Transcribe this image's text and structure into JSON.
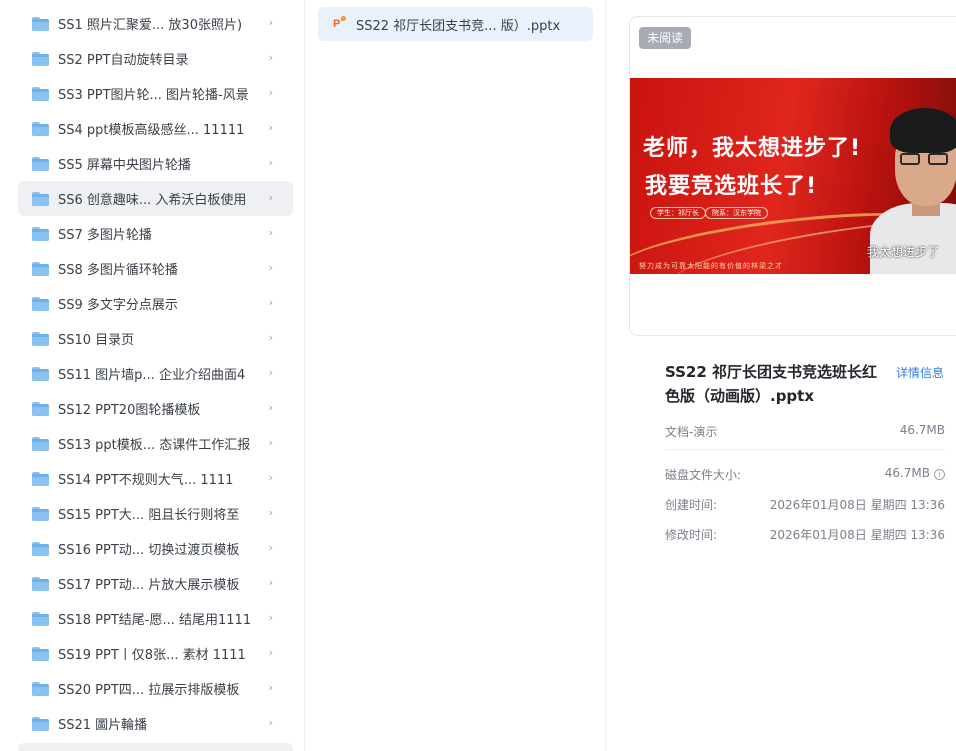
{
  "folders": [
    {
      "label": "SS1 照片汇聚爱...  放30张照片)",
      "active": false
    },
    {
      "label": "SS2 PPT自动旋转目录",
      "active": false
    },
    {
      "label": "SS3 PPT图片轮... 图片轮播-风景",
      "active": false
    },
    {
      "label": "SS4 ppt模板高级感丝...   11111",
      "active": false
    },
    {
      "label": "SS5 屏幕中央图片轮播",
      "active": false
    },
    {
      "label": "SS6 创意趣味... 入希沃白板使用",
      "active": true
    },
    {
      "label": "SS7 多图片轮播",
      "active": false
    },
    {
      "label": "SS8 多图片循环轮播",
      "active": false
    },
    {
      "label": "SS9 多文字分点展示",
      "active": false
    },
    {
      "label": "SS10 目录页",
      "active": false
    },
    {
      "label": "SS11 图片墙p...  企业介绍曲面4",
      "active": false
    },
    {
      "label": "SS12 PPT20图轮播模板",
      "active": false
    },
    {
      "label": "SS13 ppt模板... 态课件工作汇报",
      "active": false
    },
    {
      "label": "SS14 PPT不规则大气...     1111",
      "active": false
    },
    {
      "label": "SS15 PPT大...   阻且长行则将至",
      "active": false
    },
    {
      "label": "SS16 PPT动...   切换过渡页模板",
      "active": false
    },
    {
      "label": "SS17 PPT动...   片放大展示模板",
      "active": false
    },
    {
      "label": "SS18 PPT结尾-愿... 结尾用1111",
      "active": false
    },
    {
      "label": "SS19 PPT丨仅8张...   素材 1111",
      "active": false
    },
    {
      "label": "SS20 PPT四...   拉展示排版模板",
      "active": false
    },
    {
      "label": "SS21 圖片輪播",
      "active": false
    }
  ],
  "chevron": "›",
  "file": {
    "label": "SS22 祁厅长团支书竞...  版）.pptx",
    "icon": "ppt-file-icon"
  },
  "preview": {
    "badge": "未阅读",
    "slide_line1": "老师，我太想进步了!",
    "slide_line2": "我要竞选班长了!",
    "pill1": "学生：祁厅长",
    "pill2": "院系：汉东学院",
    "slide_small": "努力成为可靠太阳能的有价值的林梁之才",
    "slide_caption": "我太想进步了"
  },
  "details": {
    "title": "SS22 祁厅长团支书竞选班长红色版（动画版）.pptx",
    "detail_link": "详情信息",
    "type_label": "文档-演示",
    "type_size": "46.7MB",
    "disk_label": "磁盘文件大小:",
    "disk_value": "46.7MB",
    "created_label": "创建时间:",
    "created_value": "2026年01月08日 星期四 13:36",
    "modified_label": "修改时间:",
    "modified_value": "2026年01月08日 星期四 13:36"
  },
  "colors": {
    "accent": "#2d7be5",
    "selected_bg": "#e9f1fc",
    "hover_bg": "#eef0f4",
    "folder": "#6fb1e9",
    "slide_red": "#d41f1a"
  }
}
